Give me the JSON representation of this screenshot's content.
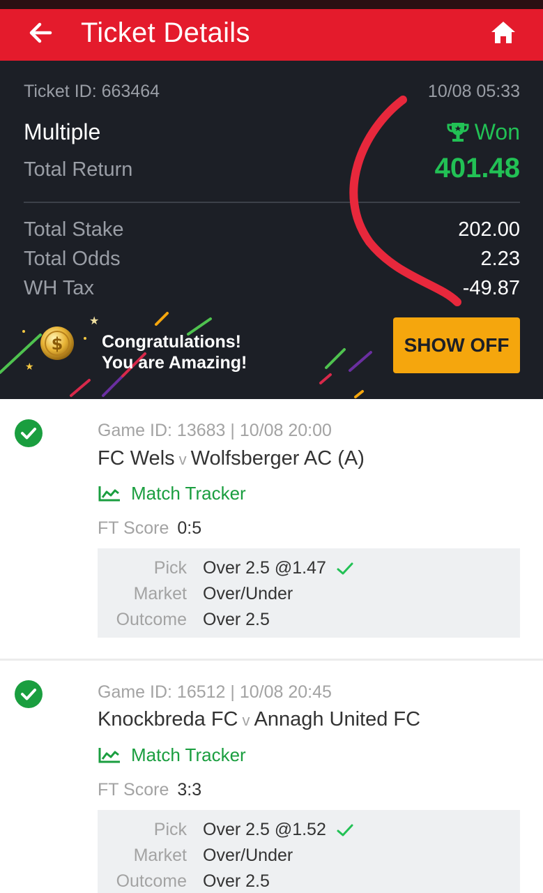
{
  "header": {
    "title": "Ticket Details"
  },
  "ticket": {
    "id_text": "Ticket ID: 663464",
    "datetime": "10/08 05:33",
    "type": "Multiple",
    "status": "Won",
    "total_return_label": "Total Return",
    "total_return": "401.48",
    "rows": [
      {
        "label": "Total Stake",
        "value": "202.00"
      },
      {
        "label": "Total Odds",
        "value": "2.23"
      },
      {
        "label": "WH Tax",
        "value": "-49.87"
      }
    ]
  },
  "promo": {
    "line1": "Congratulations!",
    "line2": "You are Amazing!",
    "button": "SHOW OFF"
  },
  "selections": [
    {
      "meta": "Game ID: 13683 | 10/08 20:00",
      "home": "FC Wels",
      "vs": "v",
      "away": "Wolfsberger AC (A)",
      "tracker": "Match Tracker",
      "ft_label": "FT Score",
      "ft_value": "0:5",
      "pick_label": "Pick",
      "pick_value": "Over 2.5 @1.47",
      "market_label": "Market",
      "market_value": "Over/Under",
      "outcome_label": "Outcome",
      "outcome_value": "Over 2.5"
    },
    {
      "meta": "Game ID: 16512 | 10/08 20:45",
      "home": "Knockbreda FC",
      "vs": "v",
      "away": "Annagh United FC",
      "tracker": "Match Tracker",
      "ft_label": "FT Score",
      "ft_value": "3:3",
      "pick_label": "Pick",
      "pick_value": "Over 2.5 @1.52",
      "market_label": "Market",
      "market_value": "Over/Under",
      "outcome_label": "Outcome",
      "outcome_value": "Over 2.5"
    }
  ],
  "colors": {
    "brand_red": "#e41b2c",
    "dark_bg": "#1c1f26",
    "win_green": "#22c155",
    "tracker_green": "#1a9e3f",
    "button_orange": "#f5a60d",
    "annotation_red": "#e8283c"
  },
  "icons": [
    "back-arrow-icon",
    "home-icon",
    "trophy-icon",
    "coin-icon",
    "check-circle-icon",
    "chart-line-icon",
    "checkmark-icon"
  ]
}
